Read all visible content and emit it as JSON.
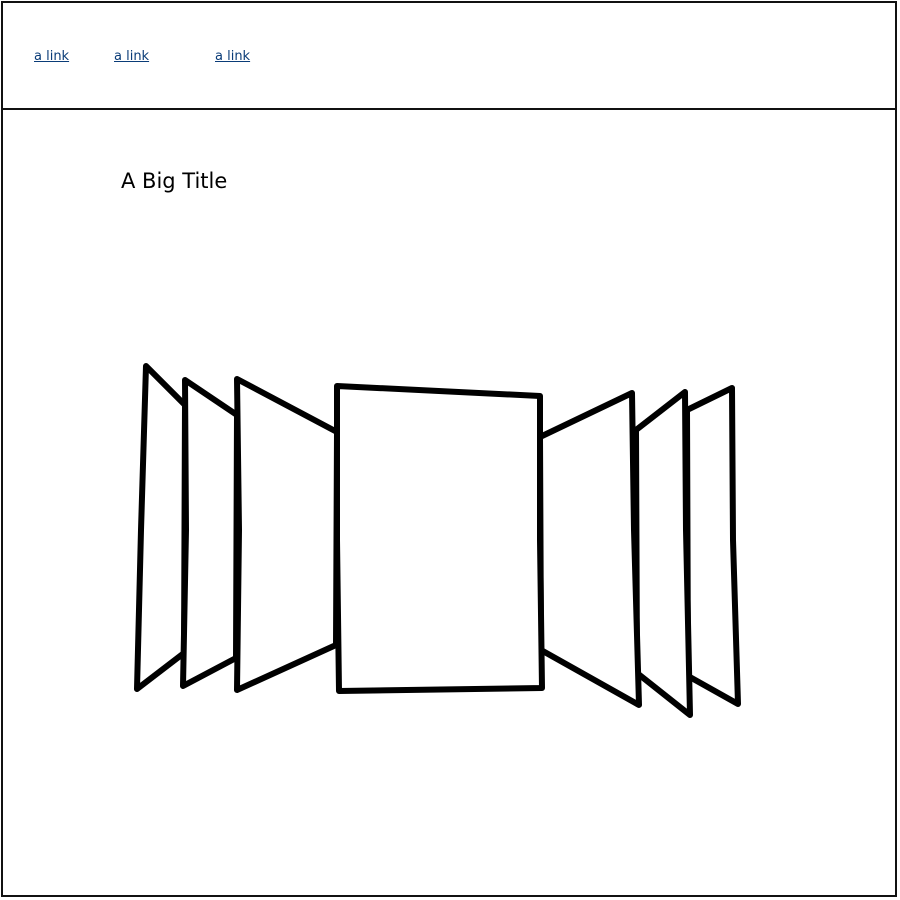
{
  "header": {
    "links": [
      {
        "label": "a link"
      },
      {
        "label": "a link"
      },
      {
        "label": "a link"
      }
    ]
  },
  "main": {
    "title": "A Big Title"
  },
  "carousel": {
    "card_count": 7,
    "active_index": 3
  }
}
